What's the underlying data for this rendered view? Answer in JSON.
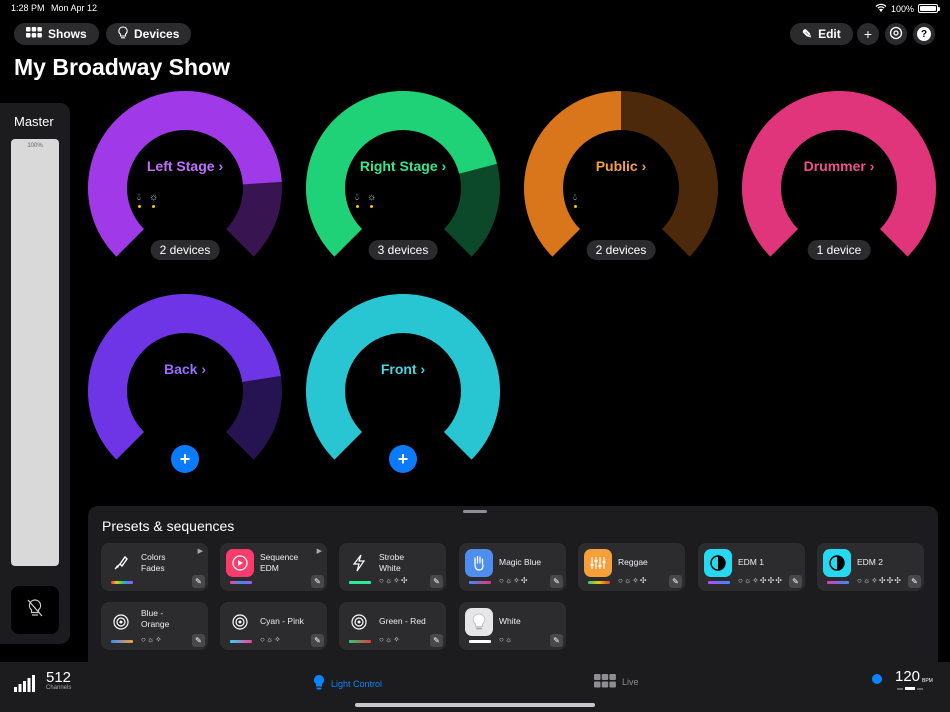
{
  "status": {
    "time": "1:28 PM",
    "date": "Mon Apr 12",
    "battery": "100%"
  },
  "nav": {
    "shows": "Shows",
    "devices": "Devices",
    "edit": "Edit"
  },
  "title": "My Broadway Show",
  "master": {
    "label": "Master",
    "level": "100%"
  },
  "groups": [
    {
      "name": "Left Stage",
      "devices": "2 devices",
      "color": "#a03ae8",
      "level": 0.82
    },
    {
      "name": "Right Stage",
      "devices": "3 devices",
      "color": "#1fd177",
      "level": 0.78
    },
    {
      "name": "Public",
      "devices": "2 devices",
      "color": "#d9761c",
      "level": 0.5
    },
    {
      "name": "Drummer",
      "devices": "1 device",
      "color": "#e0357a",
      "level": 1.0
    },
    {
      "name": "Back",
      "devices": "",
      "color": "#6d35e6",
      "level": 0.8
    },
    {
      "name": "Front",
      "devices": "",
      "color": "#27c6d2",
      "level": 1.0
    }
  ],
  "presets": {
    "title": "Presets & sequences",
    "items": [
      {
        "line1": "Colors",
        "line2": "Fades",
        "icon": "brush-icon",
        "icons": ""
      },
      {
        "line1": "Sequence",
        "line2": "EDM",
        "icon": "play-circle-icon",
        "icons": ""
      },
      {
        "line1": "Strobe",
        "line2": "White",
        "icon": "bolt-icon",
        "icons": "○☼✧✣"
      },
      {
        "line1": "Magic Blue",
        "line2": "",
        "icon": "hand-icon",
        "icons": "○☼✧✣"
      },
      {
        "line1": "Reggae",
        "line2": "",
        "icon": "equalizer-icon",
        "icons": "○☼✧✣"
      },
      {
        "line1": "EDM 1",
        "line2": "",
        "icon": "half-circle-icon",
        "icons": "○☼✧✣✣✣"
      },
      {
        "line1": "EDM 2",
        "line2": "",
        "icon": "half-circle-icon",
        "icons": "○☼✧✣✣✣"
      },
      {
        "line1": "Blue -",
        "line2": "Orange",
        "icon": "target-icon",
        "icons": "○☼✧"
      },
      {
        "line1": "Cyan - Pink",
        "line2": "",
        "icon": "target-icon",
        "icons": "○☼✧"
      },
      {
        "line1": "Green - Red",
        "line2": "",
        "icon": "target-icon",
        "icons": "○☼✧"
      },
      {
        "line1": "White",
        "line2": "",
        "icon": "bulb-icon",
        "icons": "○☼"
      }
    ]
  },
  "tabbar": {
    "channels": "512",
    "channels_label": "Channels",
    "light_control": "Light Control",
    "live": "Live",
    "bpm": "120",
    "bpm_unit": "BPM"
  }
}
